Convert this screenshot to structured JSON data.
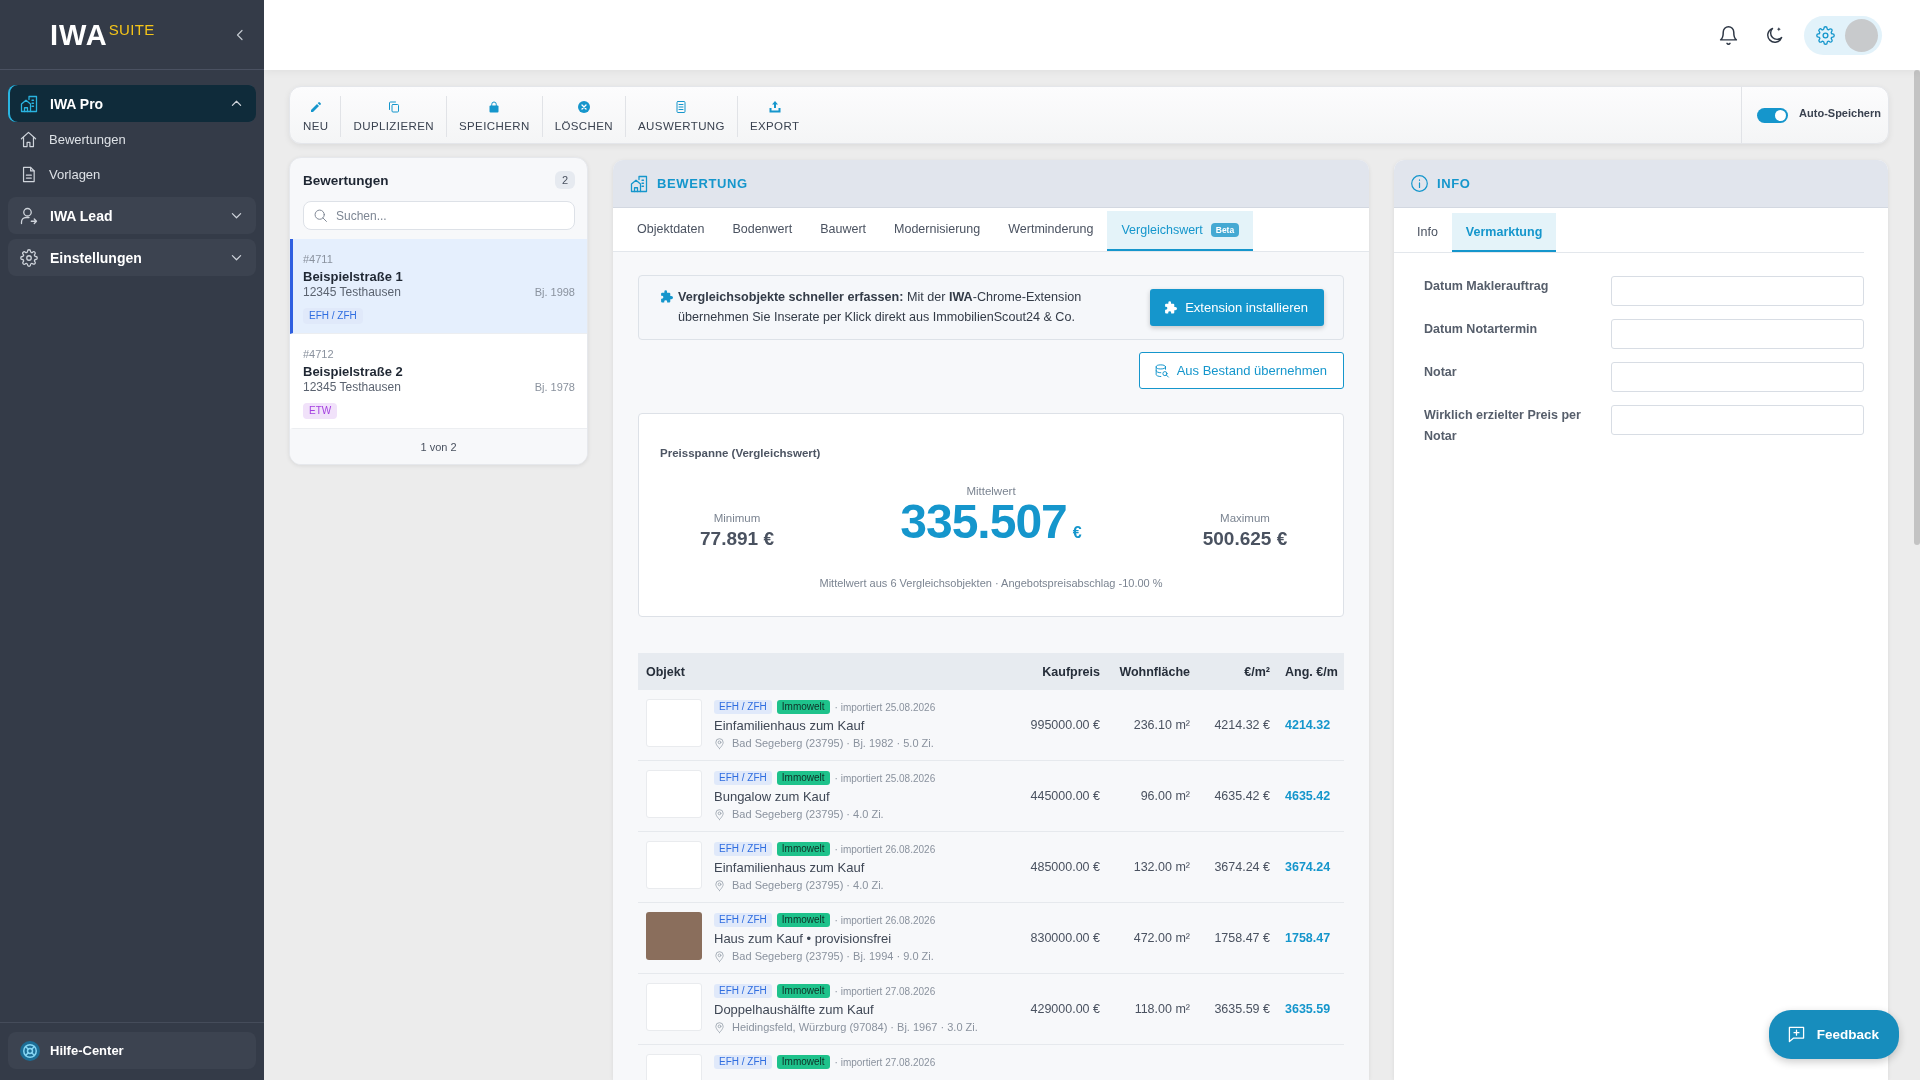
{
  "sidebar": {
    "logo": {
      "text": "IWA",
      "suffix": "SUITE"
    },
    "items": [
      {
        "label": "IWA Pro",
        "selected": true,
        "expanded": true,
        "children": [
          {
            "label": "Bewertungen",
            "selected": false
          },
          {
            "label": "Vorlagen",
            "selected": false
          }
        ]
      },
      {
        "label": "IWA Lead",
        "selected": false,
        "expanded": false
      },
      {
        "label": "Einstellungen",
        "selected": false,
        "expanded": false
      }
    ],
    "help": {
      "label": "Hilfe-Center"
    }
  },
  "toolbar": {
    "buttons": [
      {
        "label": "NEU"
      },
      {
        "label": "DUPLIZIEREN"
      },
      {
        "label": "SPEICHERN"
      },
      {
        "label": "LÖSCHEN"
      },
      {
        "label": "AUSWERTUNG"
      },
      {
        "label": "EXPORT"
      }
    ],
    "auto_save": {
      "label": "Auto-Speichern",
      "on": true
    }
  },
  "list_panel": {
    "title": "Bewertungen",
    "count": "2",
    "search": {
      "placeholder": "Suchen..."
    },
    "items": [
      {
        "number": "#4711",
        "title": "Beispielstraße 1",
        "city": "12345 Testhausen",
        "year": "Bj. 1998",
        "tag": {
          "label": "EFH / ZFH",
          "color": "#2f6de0"
        },
        "selected": true
      },
      {
        "number": "#4712",
        "title": "Beispielstraße 2",
        "city": "12345 Testhausen",
        "year": "Bj. 1978",
        "tag": {
          "label": "ETW",
          "color": "#a43fe0"
        },
        "selected": false
      }
    ],
    "pagination": "1 von 2"
  },
  "bewertung": {
    "title": "BEWERTUNG",
    "tabs": [
      {
        "label": "Objektdaten",
        "selected": false
      },
      {
        "label": "Bodenwert",
        "selected": false
      },
      {
        "label": "Bauwert",
        "selected": false
      },
      {
        "label": "Modernisierung",
        "selected": false
      },
      {
        "label": "Wertminderung",
        "selected": false
      },
      {
        "label": "Vergleichswert",
        "selected": true,
        "badge": "Beta"
      }
    ],
    "banner": {
      "text": "**Vergleichsobjekte schneller erfassen:** Mit der **IWA**-Chrome-Extension übernehmen Sie Inserate per Klick direkt aus ImmobilienScout24 & Co.",
      "button": "Extension installieren"
    },
    "import_button": "Aus Bestand übernehmen",
    "price_range": {
      "title": "Preisspanne (Vergleichswert)",
      "minimum": {
        "label": "Minimum",
        "value": "77.891 €"
      },
      "mean": {
        "label": "Mittelwert",
        "value": "335.507",
        "unit": "€"
      },
      "maximum": {
        "label": "Maximum",
        "value": "500.625 €"
      },
      "note": "Mittelwert aus 6 Vergleichsobjekten · Angebotspreisabschlag -10.00 %"
    },
    "table": {
      "columns": [
        "Objekt",
        "Kaufpreis",
        "Wohnfläche",
        "€/m²",
        "Ang. €/m"
      ],
      "rows": [
        {
          "thumbnail": {
            "kind": "logo"
          },
          "tags": [
            {
              "label": "EFH / ZFH",
              "kind": "category",
              "color": "#2f6de0"
            },
            {
              "label": "Immowelt",
              "kind": "source",
              "color": "#1ec28b"
            }
          ],
          "imported": "· importiert 25.08.2026",
          "title": "Einfamilienhaus zum Kauf",
          "location": "Bad Segeberg (23795) · Bj. 1982 · 5.0 Zi.",
          "price": "995000.00 €",
          "area": "236.10 m²",
          "price_per_sqm": "4214.32 €",
          "asking_per_sqm": "4214.32"
        },
        {
          "thumbnail": {
            "kind": "logo"
          },
          "tags": [
            {
              "label": "EFH / ZFH",
              "kind": "category",
              "color": "#2f6de0"
            },
            {
              "label": "Immowelt",
              "kind": "source",
              "color": "#1ec28b"
            }
          ],
          "imported": "· importiert 25.08.2026",
          "title": "Bungalow zum Kauf",
          "location": "Bad Segeberg (23795) · 4.0 Zi.",
          "price": "445000.00 €",
          "area": "96.00 m²",
          "price_per_sqm": "4635.42 €",
          "asking_per_sqm": "4635.42"
        },
        {
          "thumbnail": {
            "kind": "logo"
          },
          "tags": [
            {
              "label": "EFH / ZFH",
              "kind": "category",
              "color": "#2f6de0"
            },
            {
              "label": "Immowelt",
              "kind": "source",
              "color": "#1ec28b"
            }
          ],
          "imported": "· importiert 26.08.2026",
          "title": "Einfamilienhaus zum Kauf",
          "location": "Bad Segeberg (23795) · 4.0 Zi.",
          "price": "485000.00 €",
          "area": "132.00 m²",
          "price_per_sqm": "3674.24 €",
          "asking_per_sqm": "3674.24"
        },
        {
          "thumbnail": {
            "kind": "photo"
          },
          "tags": [
            {
              "label": "EFH / ZFH",
              "kind": "category",
              "color": "#2f6de0"
            },
            {
              "label": "Immowelt",
              "kind": "source",
              "color": "#1ec28b"
            }
          ],
          "imported": "· importiert 26.08.2026",
          "title": "Haus zum Kauf • provisionsfrei",
          "location": "Bad Segeberg (23795) · Bj. 1994 · 9.0 Zi.",
          "price": "830000.00 €",
          "area": "472.00 m²",
          "price_per_sqm": "1758.47 €",
          "asking_per_sqm": "1758.47"
        },
        {
          "thumbnail": {
            "kind": "logo"
          },
          "tags": [
            {
              "label": "EFH / ZFH",
              "kind": "category",
              "color": "#2f6de0"
            },
            {
              "label": "Immowelt",
              "kind": "source",
              "color": "#1ec28b"
            }
          ],
          "imported": "· importiert 27.08.2026",
          "title": "Doppelhaushälfte zum Kauf",
          "location": "Heidingsfeld, Würzburg (97084) · Bj. 1967 · 3.0 Zi.",
          "price": "429000.00 €",
          "area": "118.00 m²",
          "price_per_sqm": "3635.59 €",
          "asking_per_sqm": "3635.59"
        },
        {
          "thumbnail": {
            "kind": "logo"
          },
          "tags": [
            {
              "label": "EFH / ZFH",
              "kind": "category",
              "color": "#2f6de0"
            },
            {
              "label": "Immowelt",
              "kind": "source",
              "color": "#1ec28b"
            }
          ],
          "imported": "· importiert 27.08.2026"
        }
      ]
    }
  },
  "info": {
    "title": "INFO",
    "tabs": [
      {
        "label": "Info",
        "selected": false
      },
      {
        "label": "Vermarktung",
        "selected": true
      }
    ],
    "fields": [
      {
        "label": "Datum Maklerauftrag"
      },
      {
        "label": "Datum Notartermin"
      },
      {
        "label": "Notar"
      },
      {
        "label": "Wirklich erzielter Preis per Notar"
      }
    ]
  },
  "feedback": {
    "label": "Feedback"
  }
}
